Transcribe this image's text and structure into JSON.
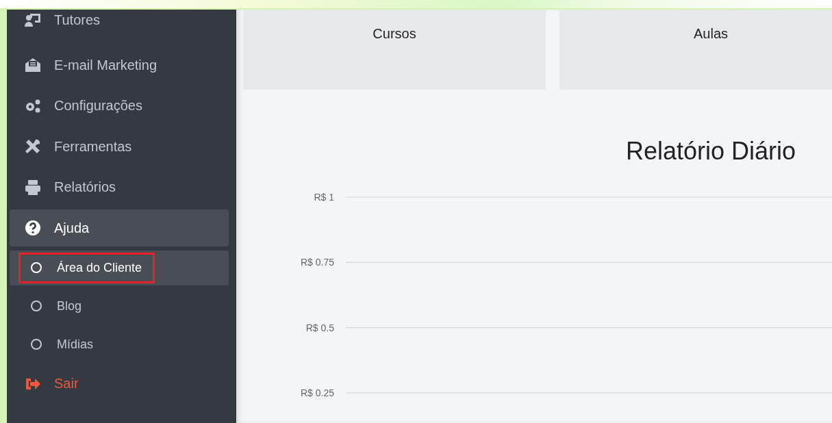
{
  "sidebar": {
    "items": [
      {
        "kind": "menu",
        "label": "Tutores"
      },
      {
        "kind": "menu",
        "label": "E-mail Marketing"
      },
      {
        "kind": "menu",
        "label": "Configurações"
      },
      {
        "kind": "menu",
        "label": "Ferramentas"
      },
      {
        "kind": "menu",
        "label": "Relatórios"
      },
      {
        "kind": "menu",
        "label": "Ajuda",
        "expanded": true,
        "children": [
          {
            "label": "Área do Cliente",
            "selected": true,
            "annotated": true
          },
          {
            "label": "Blog",
            "selected": false,
            "annotated": false
          },
          {
            "label": "Mídias",
            "selected": false,
            "annotated": false
          }
        ]
      },
      {
        "kind": "logout",
        "label": "Sair"
      }
    ]
  },
  "cards": [
    {
      "title": "Cursos"
    },
    {
      "title": "Aulas"
    }
  ],
  "chart": {
    "title": "Relatório Diário",
    "y_axis_labels": [
      "R$ 1",
      "R$ 0.75",
      "R$ 0.5",
      "R$ 0.25"
    ]
  }
}
